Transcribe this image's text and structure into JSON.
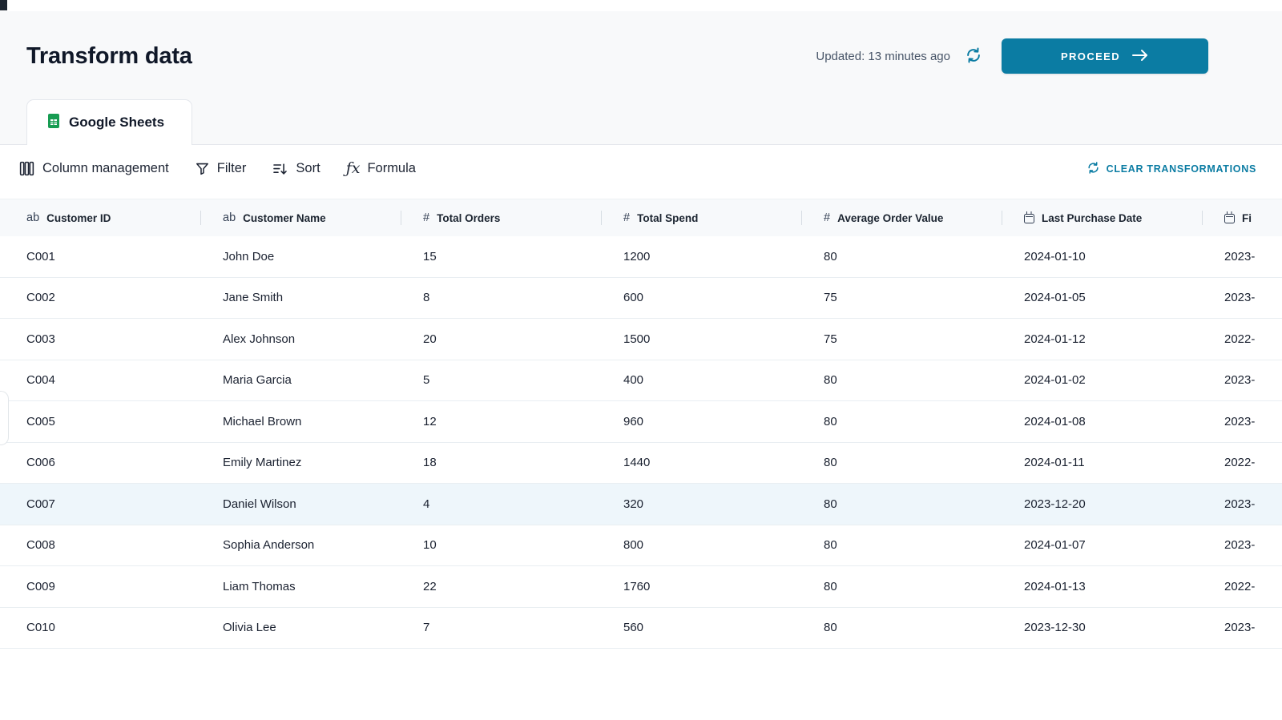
{
  "colors": {
    "accent": "#0b7ca3",
    "title_color": "#101828",
    "highlight_row": "#eef6fb",
    "sheets_green": "#179c52",
    "header_band": "#f7f9fb"
  },
  "icons": {
    "refresh-icon": "circular-arrows",
    "arrow-right-icon": "long-right-arrow",
    "google-sheets-icon": "green-spreadsheet",
    "columns-icon": "three-vertical-bars",
    "filter-icon": "funnel",
    "sort-icon": "lines-with-down-arrow",
    "formula-icon": "fx-italic",
    "text-type-icon": "ab",
    "number-type-icon": "#",
    "calendar-icon": "calendar-outline"
  },
  "header": {
    "title": "Transform data",
    "updated": "Updated: 13 minutes ago",
    "proceed_label": "PROCEED"
  },
  "tabs": [
    {
      "label": "Google Sheets"
    }
  ],
  "toolbar": {
    "items": [
      {
        "label": "Column management"
      },
      {
        "label": "Filter"
      },
      {
        "label": "Sort"
      },
      {
        "label": "Formula"
      }
    ],
    "formula_glyph": "ƒx",
    "clear_label": "CLEAR TRANSFORMATIONS"
  },
  "table": {
    "type_glyphs": {
      "text": "ab",
      "number": "#"
    },
    "columns": [
      {
        "label": "Customer ID",
        "type": "text"
      },
      {
        "label": "Customer Name",
        "type": "text"
      },
      {
        "label": "Total Orders",
        "type": "number"
      },
      {
        "label": "Total Spend",
        "type": "number"
      },
      {
        "label": "Average Order Value",
        "type": "number"
      },
      {
        "label": "Last Purchase Date",
        "type": "date"
      },
      {
        "label": "Fi",
        "type": "date"
      }
    ],
    "highlight_index": 6,
    "rows": [
      [
        "C001",
        "John Doe",
        "15",
        "1200",
        "80",
        "2024-01-10",
        "2023-"
      ],
      [
        "C002",
        "Jane Smith",
        "8",
        "600",
        "75",
        "2024-01-05",
        "2023-"
      ],
      [
        "C003",
        "Alex Johnson",
        "20",
        "1500",
        "75",
        "2024-01-12",
        "2022-"
      ],
      [
        "C004",
        "Maria Garcia",
        "5",
        "400",
        "80",
        "2024-01-02",
        "2023-"
      ],
      [
        "C005",
        "Michael Brown",
        "12",
        "960",
        "80",
        "2024-01-08",
        "2023-"
      ],
      [
        "C006",
        "Emily Martinez",
        "18",
        "1440",
        "80",
        "2024-01-11",
        "2022-"
      ],
      [
        "C007",
        "Daniel Wilson",
        "4",
        "320",
        "80",
        "2023-12-20",
        "2023-"
      ],
      [
        "C008",
        "Sophia Anderson",
        "10",
        "800",
        "80",
        "2024-01-07",
        "2023-"
      ],
      [
        "C009",
        "Liam Thomas",
        "22",
        "1760",
        "80",
        "2024-01-13",
        "2022-"
      ],
      [
        "C010",
        "Olivia Lee",
        "7",
        "560",
        "80",
        "2023-12-30",
        "2023-"
      ]
    ]
  }
}
